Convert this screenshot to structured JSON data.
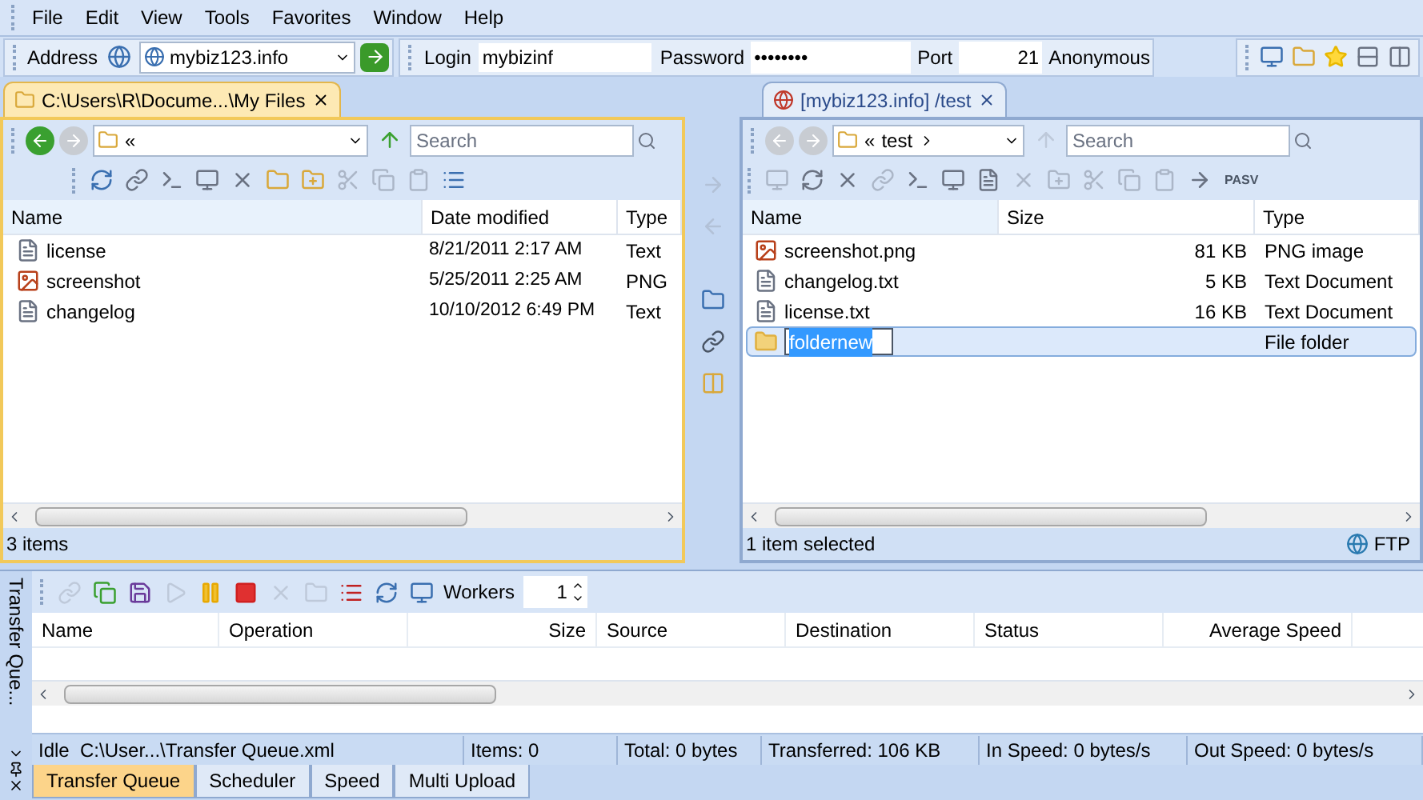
{
  "menu": [
    "File",
    "Edit",
    "View",
    "Tools",
    "Favorites",
    "Window",
    "Help"
  ],
  "connection": {
    "address_label": "Address",
    "address": "mybiz123.info",
    "login_label": "Login",
    "login": "mybizinf",
    "password_label": "Password",
    "password": "••••••••",
    "port_label": "Port",
    "port": "21",
    "anonymous": "Anonymous"
  },
  "left_pane": {
    "tab": "C:\\Users\\R\\Docume...\\My Files",
    "path": "«",
    "search": {
      "placeholder": "Search"
    },
    "columns": [
      "Name",
      "Date modified",
      "Type"
    ],
    "rows": [
      {
        "kind": "text",
        "name": "license",
        "date": "8/21/2011 2:17 AM",
        "type": "Text"
      },
      {
        "kind": "image",
        "name": "screenshot",
        "date": "5/25/2011 2:25 AM",
        "type": "PNG"
      },
      {
        "kind": "text",
        "name": "changelog",
        "date": "10/10/2012 6:49 PM",
        "type": "Text"
      }
    ],
    "status": "3 items"
  },
  "right_pane": {
    "tab": "[mybiz123.info] /test",
    "path": "«",
    "folder": "test",
    "search": {
      "placeholder": "Search"
    },
    "pasv": "PASV",
    "columns": [
      "Name",
      "Size",
      "Type"
    ],
    "rows": [
      {
        "kind": "image",
        "name": "screenshot.png",
        "size": "81 KB",
        "type": "PNG image",
        "selected": false,
        "editing": false
      },
      {
        "kind": "text",
        "name": "changelog.txt",
        "size": "5 KB",
        "type": "Text Document",
        "selected": false,
        "editing": false
      },
      {
        "kind": "text",
        "name": "license.txt",
        "size": "16 KB",
        "type": "Text Document",
        "selected": false,
        "editing": false
      },
      {
        "kind": "folder",
        "name": "foldernew",
        "size": "",
        "type": "File folder",
        "selected": true,
        "editing": true
      }
    ],
    "status": "1 item selected",
    "protocol": "FTP"
  },
  "queue": {
    "side_title": "Transfer Que...",
    "workers_label": "Workers",
    "workers": "1",
    "columns": [
      "Name",
      "Operation",
      "Size",
      "Source",
      "Destination",
      "Status",
      "Average Speed"
    ],
    "status": [
      "Idle  C:\\User...\\Transfer Queue.xml",
      "Items: 0",
      "Total: 0 bytes",
      "Transferred: 106 KB",
      "In Speed: 0 bytes/s",
      "Out Speed: 0 bytes/s"
    ],
    "tabs": [
      {
        "label": "Transfer Queue",
        "selected": true
      },
      {
        "label": "Scheduler",
        "selected": false
      },
      {
        "label": "Speed",
        "selected": false
      },
      {
        "label": "Multi Upload",
        "selected": false
      }
    ]
  }
}
